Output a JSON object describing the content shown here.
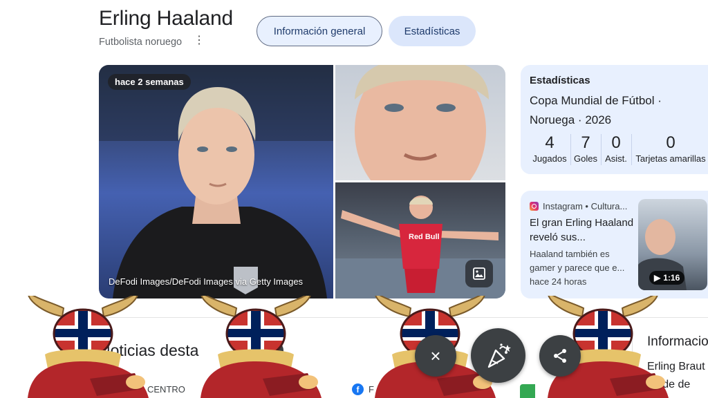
{
  "header": {
    "title": "Erling Haaland",
    "subtitle": "Futbolista noruego",
    "more_icon": "more-vert-icon"
  },
  "tabs": [
    {
      "label": "Información general",
      "active": true
    },
    {
      "label": "Estadísticas",
      "active": false
    }
  ],
  "gallery": {
    "time_badge": "hace 2 semanas",
    "credit": "DeFodi Images/DeFodi Images via Getty Images",
    "image_icon": "image-icon"
  },
  "stats_card": {
    "heading": "Estadísticas",
    "competition": "Copa Mundial de Fútbol · Noruega · 2026",
    "items": [
      {
        "value": "4",
        "label": "Jugados"
      },
      {
        "value": "7",
        "label": "Goles"
      },
      {
        "value": "0",
        "label": "Asist."
      },
      {
        "value": "0",
        "label": "Tarjetas amarillas"
      }
    ]
  },
  "news_card": {
    "source": "Instagram • Cultura...",
    "title": "El gran Erling Haaland reveló sus...",
    "snippet": "Haaland también es gamer y parece que e...",
    "time": "hace 24 horas",
    "video_duration": "1:16"
  },
  "lower": {
    "news_section_title": "Noticias desta",
    "info_title": "Informacion",
    "info_body_line1": "Erling Braut",
    "info_body_line2": "na de de",
    "peek_source_1": "CENTRO",
    "peek_source_2": "F"
  },
  "overlay": {
    "close_label": "×",
    "close_icon": "close-icon",
    "celebrate_icon": "party-popper-icon",
    "share_icon": "share-icon",
    "mascot": "norway-viking-mascot"
  },
  "colors": {
    "tab_active_bg": "#e8f0fe",
    "card_bg": "#e8f0fe",
    "fab_bg": "#3c4043",
    "jersey_red": "#d7263d",
    "flag_blue": "#00205b"
  }
}
